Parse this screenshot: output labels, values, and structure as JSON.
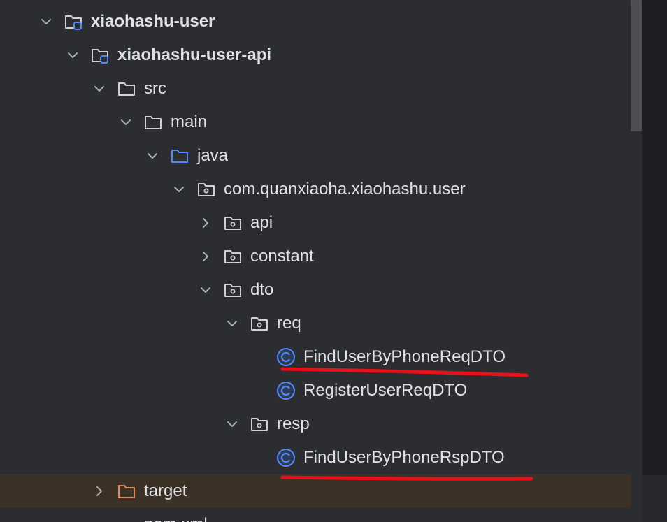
{
  "tree": {
    "items": [
      {
        "label": "xiaohashu-user",
        "bold": true,
        "depth": 0,
        "expanded": true,
        "icon": "module-folder-icon"
      },
      {
        "label": "xiaohashu-user-api",
        "bold": true,
        "depth": 1,
        "expanded": true,
        "icon": "module-folder-icon"
      },
      {
        "label": "src",
        "bold": false,
        "depth": 2,
        "expanded": true,
        "icon": "folder-icon"
      },
      {
        "label": "main",
        "bold": false,
        "depth": 3,
        "expanded": true,
        "icon": "folder-icon"
      },
      {
        "label": "java",
        "bold": false,
        "depth": 4,
        "expanded": true,
        "icon": "source-folder-icon"
      },
      {
        "label": "com.quanxiaoha.xiaohashu.user",
        "bold": false,
        "depth": 5,
        "expanded": true,
        "icon": "package-icon"
      },
      {
        "label": "api",
        "bold": false,
        "depth": 6,
        "expanded": false,
        "icon": "package-icon"
      },
      {
        "label": "constant",
        "bold": false,
        "depth": 6,
        "expanded": false,
        "icon": "package-icon"
      },
      {
        "label": "dto",
        "bold": false,
        "depth": 6,
        "expanded": true,
        "icon": "package-icon"
      },
      {
        "label": "req",
        "bold": false,
        "depth": 7,
        "expanded": true,
        "icon": "package-icon"
      },
      {
        "label": "FindUserByPhoneReqDTO",
        "bold": false,
        "depth": 8,
        "expanded": null,
        "icon": "class-icon",
        "underlined": true
      },
      {
        "label": "RegisterUserReqDTO",
        "bold": false,
        "depth": 8,
        "expanded": null,
        "icon": "class-icon"
      },
      {
        "label": "resp",
        "bold": false,
        "depth": 7,
        "expanded": true,
        "icon": "package-icon"
      },
      {
        "label": "FindUserByPhoneRspDTO",
        "bold": false,
        "depth": 8,
        "expanded": null,
        "icon": "class-icon",
        "underlined": true
      },
      {
        "label": "target",
        "bold": false,
        "depth": 2,
        "expanded": false,
        "icon": "excluded-folder-icon",
        "highlighted": true
      },
      {
        "label": "pom.xml",
        "bold": false,
        "depth": 2,
        "expanded": null,
        "icon": "maven-icon"
      }
    ]
  },
  "colors": {
    "background": "#2b2d30",
    "text": "#dfe1e5",
    "chevron": "#a8adb7",
    "folder_stroke": "#ced0d6",
    "source_folder": "#548af7",
    "module_badge": "#548af7",
    "class_icon": "#548af7",
    "excluded_folder": "#d68a5f",
    "highlight_row": "#3b3126",
    "annotation_underline": "#e8101a"
  }
}
